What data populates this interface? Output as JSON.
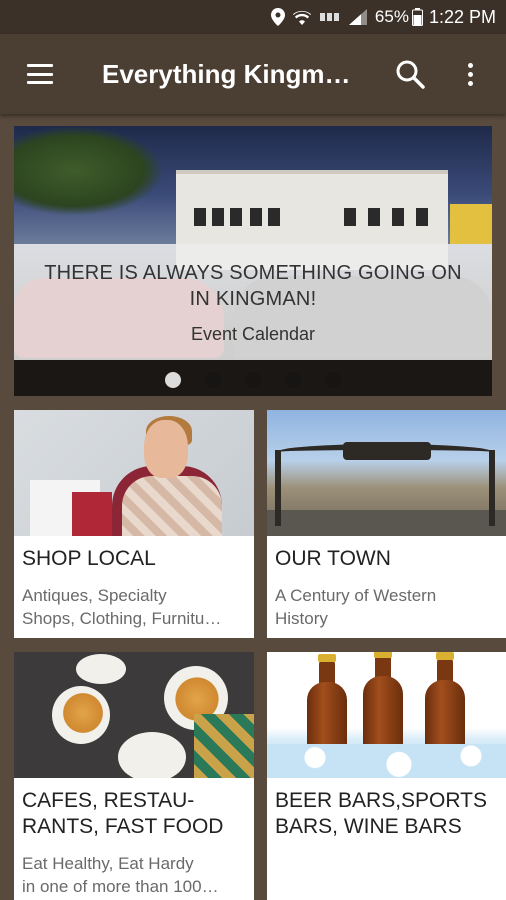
{
  "status_bar": {
    "battery_percent": "65%",
    "time": "1:22 PM",
    "icons": [
      "location-icon",
      "wifi-icon",
      "data-icon",
      "signal-icon",
      "battery-icon"
    ]
  },
  "app_bar": {
    "title": "Everything Kingma…",
    "icons": [
      "menu-icon",
      "search-icon",
      "more-vert-icon"
    ]
  },
  "hero": {
    "headline_line1": "THERE IS ALWAYS SOMETHING GOING ON",
    "headline_line2": "IN KINGMAN!",
    "subtitle": "Event Calendar",
    "page_count": 5,
    "active_page": 0
  },
  "cards": [
    {
      "title_lines": [
        "SHOP LOCAL"
      ],
      "desc_lines": [
        "Antiques, Specialty",
        "Shops, Clothing, Furnitu…"
      ]
    },
    {
      "title_lines": [
        "OUR TOWN"
      ],
      "desc_lines": [
        "A Century of Western",
        "History"
      ]
    },
    {
      "title_lines": [
        "CAFES, RESTAU-",
        "RANTS, FAST FOOD"
      ],
      "desc_lines": [
        "Eat Healthy, Eat Hardy",
        "in one of more than 100…"
      ]
    },
    {
      "title_lines": [
        "BEER BARS,SPORTS",
        "BARS, WINE BARS"
      ],
      "desc_lines": []
    }
  ],
  "colors": {
    "status_bar": "#3b3128",
    "app_bar": "#4b3e32",
    "background": "#584a3c",
    "card": "#ffffff",
    "title_text": "#222222",
    "desc_text": "#6a6a6a"
  }
}
